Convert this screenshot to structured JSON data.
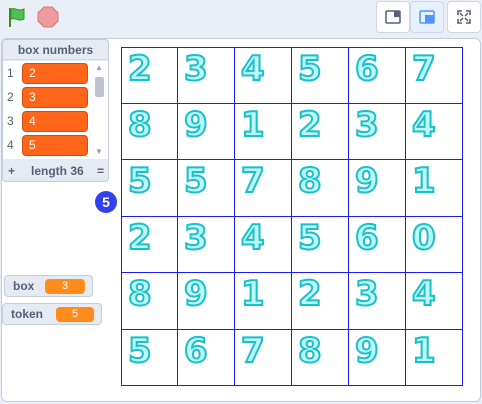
{
  "toolbar": {
    "flag_icon": "green-flag-icon",
    "stop_icon": "stop-icon",
    "small_stage_icon": "small-stage-icon",
    "normal_stage_icon": "normal-stage-icon",
    "fullscreen_icon": "fullscreen-icon"
  },
  "list": {
    "title": "box numbers",
    "items": [
      {
        "index": "1",
        "value": "2"
      },
      {
        "index": "2",
        "value": "3"
      },
      {
        "index": "3",
        "value": "4"
      },
      {
        "index": "4",
        "value": "5"
      }
    ],
    "add": "+",
    "length": "length 36",
    "resize": "="
  },
  "sprite_bubble": "5",
  "variables": [
    {
      "label": "box",
      "value": "3"
    },
    {
      "label": "token",
      "value": "5"
    }
  ],
  "grid": [
    [
      "2",
      "3",
      "4",
      "5",
      "6",
      "7"
    ],
    [
      "8",
      "9",
      "1",
      "2",
      "3",
      "4"
    ],
    [
      "5",
      "5",
      "7",
      "8",
      "9",
      "1"
    ],
    [
      "2",
      "3",
      "4",
      "5",
      "6",
      "0"
    ],
    [
      "8",
      "9",
      "1",
      "2",
      "3",
      "4"
    ],
    [
      "5",
      "6",
      "7",
      "8",
      "9",
      "1"
    ]
  ],
  "colors": {
    "list_item": "#ff661a",
    "variable_value": "#ff8c1a",
    "grid_line": "#1a1aff",
    "digit_stroke": "#16c1c9",
    "bubble": "#3340f0"
  }
}
